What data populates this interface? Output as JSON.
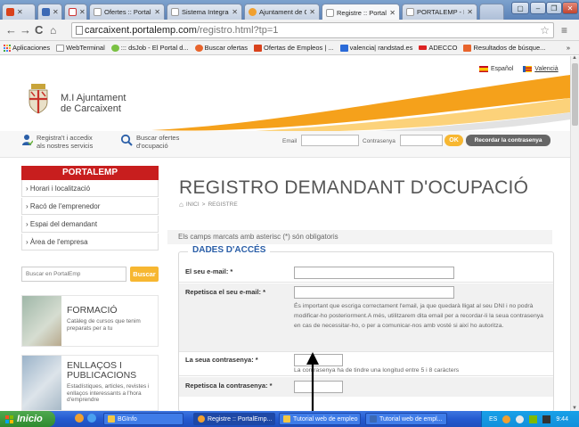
{
  "browser": {
    "tabs": [
      {
        "label": "",
        "color": "#d9421c"
      },
      {
        "label": "",
        "color": "#3b69b5"
      },
      {
        "label": "",
        "color": "#c33"
      },
      {
        "label": "Ofertes :: PortalE",
        "color": "#eee"
      },
      {
        "label": "Sistema Integrado",
        "color": "#eee"
      },
      {
        "label": "Ajuntament de Ca",
        "color": "#f0a030"
      },
      {
        "label": "Registre :: PortalE",
        "color": "#eee"
      },
      {
        "label": "PORTALEMP - Port",
        "color": "#eee"
      }
    ],
    "url_host": "carcaixent.portalemp.com",
    "url_path": "/registro.html?tp=1",
    "bookmarks": [
      {
        "label": "Aplicaciones",
        "color": "#e44"
      },
      {
        "label": "WebTerminal",
        "color": "#fff"
      },
      {
        "label": "::: dsJob - El Portal d...",
        "color": "#7ac143"
      },
      {
        "label": "Buscar ofertas",
        "color": "#e8642c"
      },
      {
        "label": "Ofertas de Empleos | ...",
        "color": "#d9421c"
      },
      {
        "label": "valencia| randstad.es",
        "color": "#2a6ad8"
      },
      {
        "label": "ADECCO",
        "color": "#d22"
      },
      {
        "label": "Resultados de búsque...",
        "color": "#e8642c"
      }
    ],
    "more_bookmarks": "»"
  },
  "site": {
    "org_line1": "M.I Ajuntament",
    "org_line2": "de Carcaixent",
    "lang_es": "Español",
    "lang_va": "Valencià",
    "register_line1": "Registra't i accedix",
    "register_line2": "als nostres servicis",
    "search_line1": "Buscar ofertes",
    "search_line2": "d'ocupació",
    "email_label": "Email",
    "password_label": "Contrasenya",
    "ok_label": "OK",
    "remember_label": "Recordar la contrasenya"
  },
  "sidebar": {
    "title": "PORTALEMP",
    "items": [
      {
        "label": "Horari i localització"
      },
      {
        "label": "Racó de l'emprenedor"
      },
      {
        "label": "Espai del demandant"
      },
      {
        "label": "Àrea de l'empresa"
      }
    ],
    "search_placeholder": "Buscar en PortalEmp",
    "search_button": "Buscar",
    "promos": [
      {
        "title": "FORMACIÓ",
        "desc": "Catàleg de cursos que tenim preparats per a tu"
      },
      {
        "title_line1": "ENLLAÇOS I",
        "title_line2": "PUBLICACIONS",
        "desc": "Estadístiques, articles, revistes i enllaços interessants a l'hora d'emprendre"
      }
    ]
  },
  "main": {
    "title": "REGISTRO DEMANDANT D'OCUPACIÓ",
    "breadcrumb_home": "INICI",
    "breadcrumb_sep": ">",
    "breadcrumb_current": "REGISTRE",
    "required_note": "Els camps marcats amb asterisc (*) són obligatoris",
    "section_title": "DADES D'ACCÉS",
    "fields": {
      "email": "El seu e-mail: *",
      "email_repeat": "Repetisca el seu e-mail: *",
      "email_help": "És important que escriga correctament l'email, ja que quedarà lligat al seu DNI i no podrà modificar-ho posteriorment.A més, utilitzarem dita email per a recordar-li la seua contrasenya en cas de necessitar-ho, o per a comunicar-nos amb vosté si així ho autoritza.",
      "password": "La seua contrasenya: *",
      "password_help": "La contrasenya ha de tindre una longitud entre 5 i 8 caràcters",
      "password_repeat": "Repetisca la contrasenya: *"
    }
  },
  "taskbar": {
    "start": "Inicio",
    "items": [
      {
        "label": "BGInfo",
        "color": "#f2c744"
      },
      {
        "label": "Registre :: PortalEmp...",
        "color": "#f0a030"
      },
      {
        "label": "Tutorial web de empleo",
        "color": "#f2c744"
      },
      {
        "label": "Tutorial web de empl...",
        "color": "#3b69b5"
      }
    ],
    "lang": "ES",
    "time": "9:44"
  },
  "colors": {
    "accent_red": "#c81e1e",
    "accent_orange": "#f7b731",
    "section_blue": "#2b5fa8"
  }
}
